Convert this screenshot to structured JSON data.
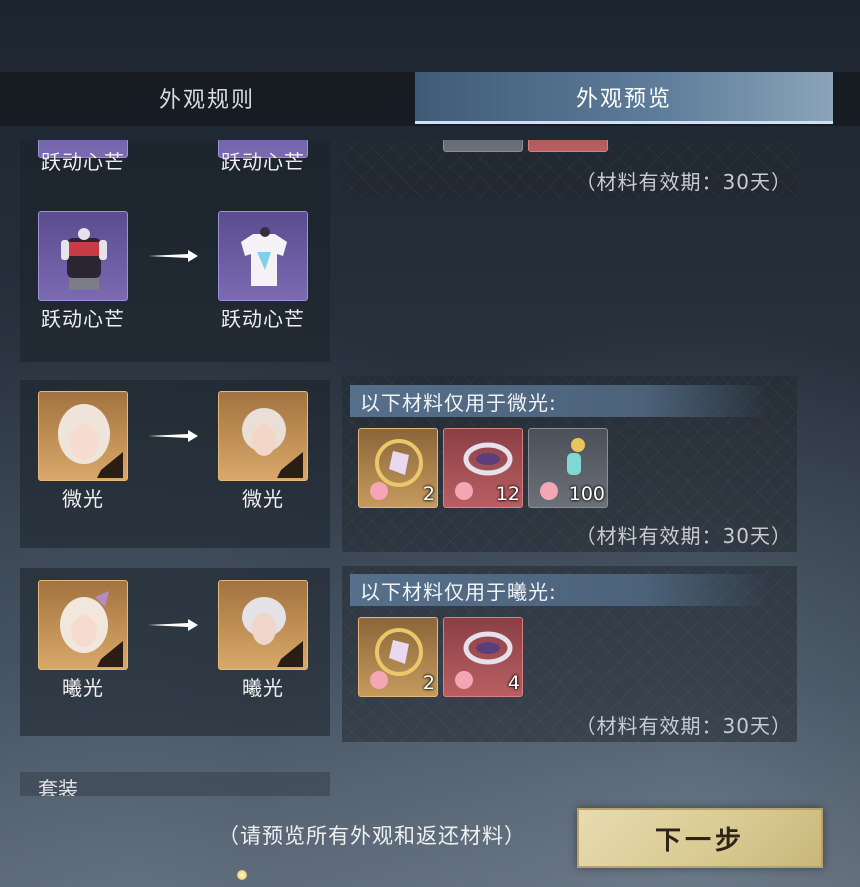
{
  "tabs": [
    {
      "label": "外观规则",
      "active": false
    },
    {
      "label": "外观预览",
      "active": true
    }
  ],
  "rows": [
    {
      "from_label": "跃动心芒",
      "to_label": "跃动心芒",
      "validity": "（材料有效期：30天）"
    },
    {
      "from_label": "跃动心芒",
      "to_label": "跃动心芒"
    },
    {
      "from_label": "微光",
      "to_label": "微光",
      "materials_header": "以下材料仅用于微光:",
      "materials": [
        {
          "count": "2",
          "color": "gold"
        },
        {
          "count": "12",
          "color": "red"
        },
        {
          "count": "100",
          "color": "gray"
        }
      ],
      "validity": "（材料有效期：30天）"
    },
    {
      "from_label": "曦光",
      "to_label": "曦光",
      "materials_header": "以下材料仅用于曦光:",
      "materials": [
        {
          "count": "2",
          "color": "gold"
        },
        {
          "count": "4",
          "color": "red"
        }
      ],
      "validity": "（材料有效期：30天）"
    }
  ],
  "section_label": "套装",
  "footer": {
    "note": "（请预览所有外观和返还材料）",
    "next_button": "下一步"
  },
  "colors": {
    "tab_active": "#5f7e9b",
    "button_gold": "#d9cb93",
    "rarity_purple": "#7a6ab2",
    "rarity_orange": "#d9a86a"
  }
}
